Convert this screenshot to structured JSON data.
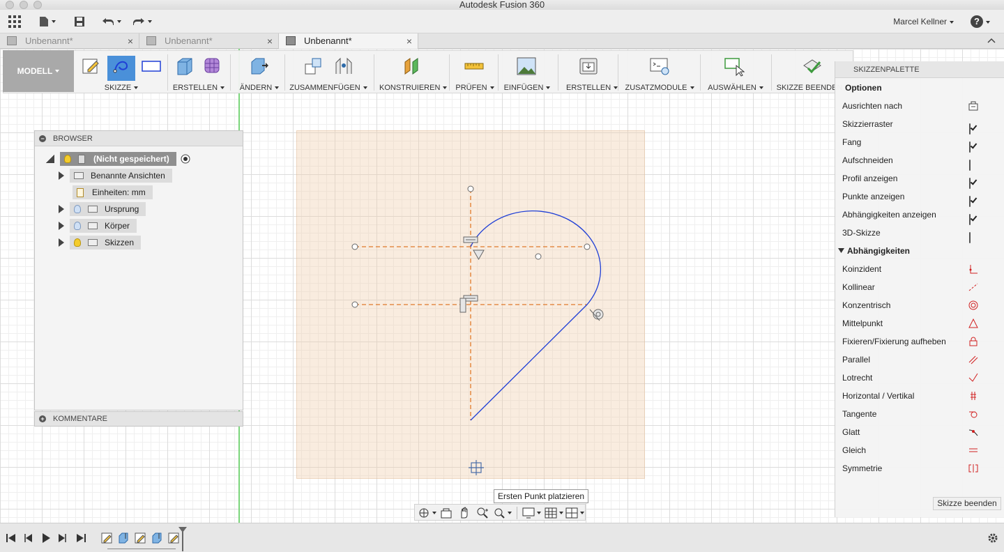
{
  "window": {
    "title": "Autodesk Fusion 360"
  },
  "appbar": {
    "user_name": "Marcel Kellner",
    "icons": [
      "grid-icon",
      "file-icon",
      "save-icon",
      "undo-icon",
      "redo-icon",
      "help-icon"
    ],
    "help_label": "?"
  },
  "tabs": [
    {
      "label": "Unbenannt*",
      "active": false
    },
    {
      "label": "Unbenannt*",
      "active": false
    },
    {
      "label": "Unbenannt*",
      "active": true
    }
  ],
  "tab_close": "×",
  "toolbar": {
    "workspace": "MODELL",
    "groups": [
      {
        "label": "SKIZZE",
        "icons": [
          "create-sketch-icon",
          "spline-icon",
          "rectangle-icon"
        ]
      },
      {
        "label": "ERSTELLEN",
        "icons": [
          "box-icon",
          "form-icon"
        ]
      },
      {
        "label": "ÄNDERN",
        "icons": [
          "press-pull-icon"
        ]
      },
      {
        "label": "ZUSAMMENFÜGEN",
        "icons": [
          "new-component-icon",
          "joint-icon"
        ]
      },
      {
        "label": "KONSTRUIEREN",
        "icons": [
          "offset-plane-icon"
        ]
      },
      {
        "label": "PRÜFEN",
        "icons": [
          "measure-icon"
        ]
      },
      {
        "label": "EINFÜGEN",
        "icons": [
          "insert-image-icon"
        ]
      },
      {
        "label": "ERSTELLEN",
        "icons": [
          "make-icon"
        ]
      },
      {
        "label": "ZUSATZMODULE",
        "icons": [
          "scripts-icon"
        ]
      },
      {
        "label": "AUSWÄHLEN",
        "icons": [
          "select-icon"
        ]
      },
      {
        "label": "SKIZZE BEENDEN",
        "icons": [
          "finish-sketch-icon"
        ]
      }
    ]
  },
  "browser": {
    "title": "BROWSER",
    "root": "(Nicht gespeichert)",
    "items": [
      {
        "label": "Benannte Ansichten",
        "bulb": "none",
        "expand": true
      },
      {
        "label": "Einheiten: mm",
        "bulb": "none",
        "expand": false
      },
      {
        "label": "Ursprung",
        "bulb": "off",
        "expand": true
      },
      {
        "label": "Körper",
        "bulb": "off",
        "expand": true
      },
      {
        "label": "Skizzen",
        "bulb": "on",
        "expand": true
      }
    ]
  },
  "comments": {
    "title": "KOMMENTARE"
  },
  "palette": {
    "title": "SKIZZENPALETTE",
    "options_title": "Optionen",
    "options": [
      {
        "label": "Ausrichten nach",
        "control": "look-at-icon"
      },
      {
        "label": "Skizzierraster",
        "control": "checkbox",
        "checked": true
      },
      {
        "label": "Fang",
        "control": "checkbox",
        "checked": true
      },
      {
        "label": "Aufschneiden",
        "control": "checkbox",
        "checked": false
      },
      {
        "label": "Profil anzeigen",
        "control": "checkbox",
        "checked": true
      },
      {
        "label": "Punkte anzeigen",
        "control": "checkbox",
        "checked": true
      },
      {
        "label": "Abhängigkeiten anzeigen",
        "control": "checkbox",
        "checked": true
      },
      {
        "label": "3D-Skizze",
        "control": "checkbox",
        "checked": false
      }
    ],
    "constraints_title": "Abhängigkeiten",
    "constraints": [
      {
        "label": "Koinzident",
        "icon": "coincident-icon"
      },
      {
        "label": "Kollinear",
        "icon": "collinear-icon"
      },
      {
        "label": "Konzentrisch",
        "icon": "concentric-icon"
      },
      {
        "label": "Mittelpunkt",
        "icon": "midpoint-icon"
      },
      {
        "label": "Fixieren/Fixierung aufheben",
        "icon": "fix-icon"
      },
      {
        "label": "Parallel",
        "icon": "parallel-icon"
      },
      {
        "label": "Lotrecht",
        "icon": "perpendicular-icon"
      },
      {
        "label": "Horizontal / Vertikal",
        "icon": "horizontal-vertical-icon"
      },
      {
        "label": "Tangente",
        "icon": "tangent-icon"
      },
      {
        "label": "Glatt",
        "icon": "smooth-icon"
      },
      {
        "label": "Gleich",
        "icon": "equal-icon"
      },
      {
        "label": "Symmetrie",
        "icon": "symmetry-icon"
      }
    ],
    "finish_button": "Skizze beenden"
  },
  "tooltip": "Ersten Punkt platzieren",
  "colors": {
    "sketch_line": "#1f3fd6",
    "construction_line": "#e07a2a",
    "constraint_icon": "#d11f1f",
    "selected_tool": "#4a90d9"
  },
  "navbar_icons": [
    "orbit-icon",
    "look-at-icon",
    "pan-icon",
    "zoom-icon",
    "fit-icon",
    "display-settings-icon",
    "grid-settings-icon",
    "viewports-icon"
  ],
  "timeline_icons": [
    "first-icon",
    "previous-icon",
    "play-icon",
    "next-icon",
    "last-icon",
    "settings-gear-icon"
  ]
}
